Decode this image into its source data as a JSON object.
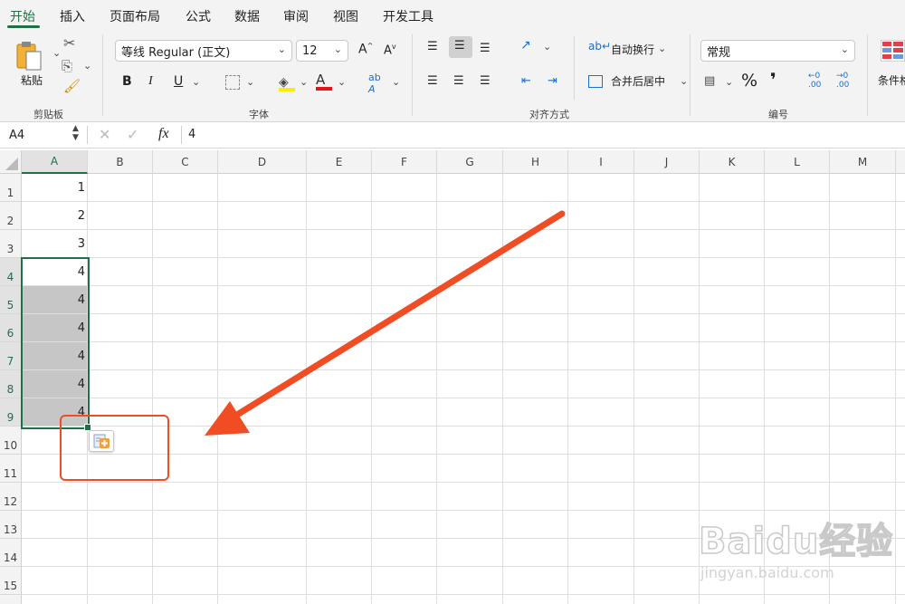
{
  "tabs": [
    "开始",
    "插入",
    "页面布局",
    "公式",
    "数据",
    "审阅",
    "视图",
    "开发工具"
  ],
  "ribbon": {
    "clipboard": {
      "paste_label": "粘贴",
      "group_label": "剪贴板"
    },
    "font": {
      "font_name": "等线 Regular (正文)",
      "font_size": "12",
      "grow": "A",
      "shrink": "A",
      "bold": "B",
      "italic": "I",
      "underline": "U",
      "group_label": "字体"
    },
    "alignment": {
      "wrap_label": "自动换行",
      "merge_label": "合并后居中",
      "group_label": "对齐方式"
    },
    "number": {
      "format": "常规",
      "percent": "%",
      "comma": "❜",
      "inc_decimal_top": "←0",
      "inc_decimal_bottom": ".00",
      "dec_decimal_top": "→0",
      "dec_decimal_bottom": ".00",
      "group_label": "编号"
    },
    "styles": {
      "conditional_label": "条件格"
    }
  },
  "formula_bar": {
    "name_box": "A4",
    "fx": "fx",
    "content": "4"
  },
  "columns": [
    "A",
    "B",
    "C",
    "D",
    "E",
    "F",
    "G",
    "H",
    "I",
    "J",
    "K",
    "L",
    "M"
  ],
  "rows": [
    "1",
    "2",
    "3",
    "4",
    "5",
    "6",
    "7",
    "8",
    "9",
    "10",
    "11",
    "12",
    "13",
    "14",
    "15"
  ],
  "cells_a": [
    "1",
    "2",
    "3",
    "4",
    "4",
    "4",
    "4",
    "4",
    "4"
  ],
  "colors": {
    "accent": "#1e7145",
    "selection_fill": "#c6c6c6",
    "arrow": "#f04d24"
  },
  "watermark": {
    "brand": "Baidu经验",
    "url": "jingyan.baidu.com"
  }
}
